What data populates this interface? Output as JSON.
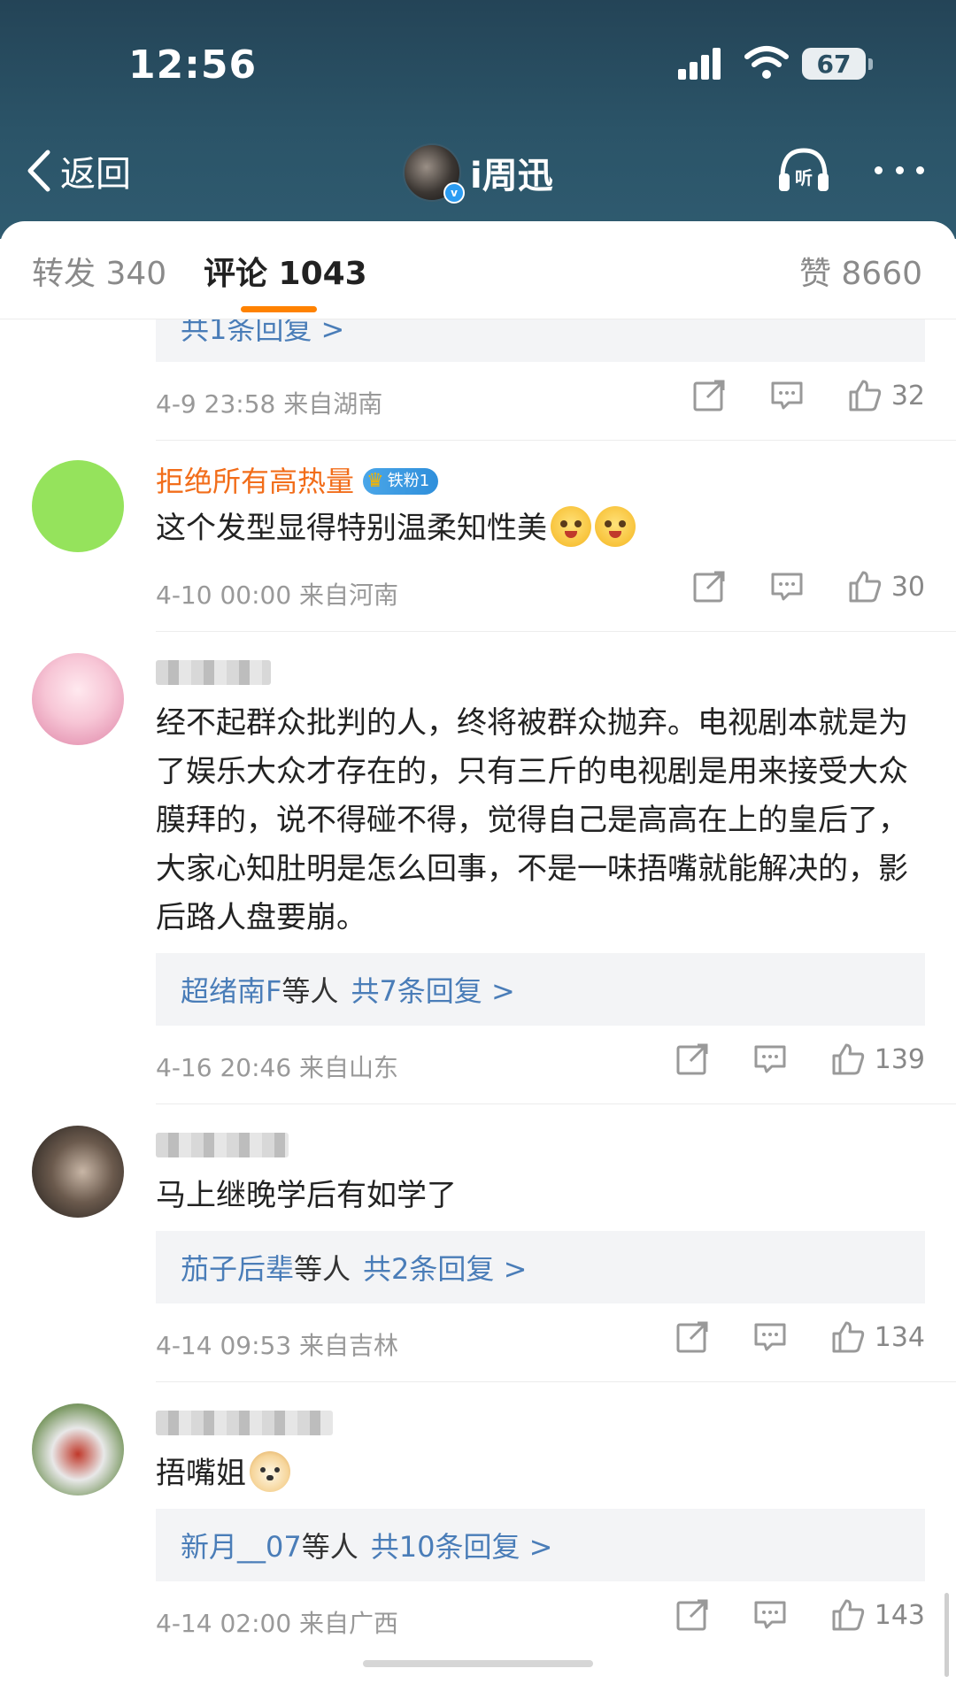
{
  "status_bar": {
    "time": "12:56",
    "battery": "67"
  },
  "nav": {
    "back_label": "返回",
    "profile_name": "i周迅"
  },
  "tabs": {
    "repost": "转发 340",
    "comments": "评论 1043",
    "likes": "赞 8660"
  },
  "top_partial": {
    "reply_summary": "共1条回复 >",
    "meta": "4-9 23:58 来自湖南",
    "likes": "32"
  },
  "comments": [
    {
      "name": "拒绝所有高热量",
      "badge": "铁粉1",
      "text": "这个发型显得特别温柔知性美",
      "meta": "4-10 00:00 来自河南",
      "likes": "30",
      "avatar_color": "#95e35c"
    },
    {
      "text": "经不起群众批判的人，终将被群众抛弃。电视剧本就是为了娱乐大众才存在的，只有三斤的电视剧是用来接受大众膜拜的，说不得碰不得，觉得自己是高高在上的皇后了，大家心知肚明是怎么回事，不是一味捂嘴就能解决的，影后路人盘要崩。",
      "reply_names": "超绪南F",
      "reply_etc": "等人",
      "reply_count": "共7条回复 >",
      "meta": "4-16 20:46 来自山东",
      "likes": "139"
    },
    {
      "text": "马上继晚学后有如学了",
      "reply_names": "茄子后辈",
      "reply_etc": "等人",
      "reply_count": "共2条回复 >",
      "meta": "4-14 09:53 来自吉林",
      "likes": "134"
    },
    {
      "text": "捂嘴姐",
      "reply_names": "新月__07",
      "reply_etc": "等人",
      "reply_count": "共10条回复 >",
      "meta": "4-14 02:00 来自广西",
      "likes": "143"
    }
  ],
  "colors": {
    "header_bg": "#2b5468",
    "accent": "#ff8200",
    "link": "#4a7db8",
    "vip_name": "#f26d1a"
  },
  "icons": [
    "back-chevron-icon",
    "listen-icon",
    "more-icon",
    "share-icon",
    "comment-icon",
    "like-icon"
  ]
}
